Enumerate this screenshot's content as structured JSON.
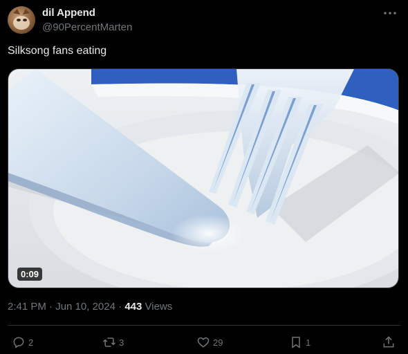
{
  "author": {
    "display_name": "dil Append",
    "handle": "@90PercentMarten",
    "avatar_icon": "avatar-image"
  },
  "tweet": {
    "text": "Silksong fans eating",
    "video_duration": "0:09"
  },
  "meta": {
    "time": "2:41 PM",
    "separator1": "·",
    "date": "Jun 10, 2024",
    "separator2": "·",
    "views_count": "443",
    "views_label": "Views"
  },
  "actions": {
    "replies": "2",
    "reposts": "3",
    "likes": "29",
    "bookmarks": "1"
  },
  "colors": {
    "background": "#000000",
    "text_primary": "#e7e9ea",
    "text_secondary": "#71767b",
    "border": "#2f3336"
  }
}
